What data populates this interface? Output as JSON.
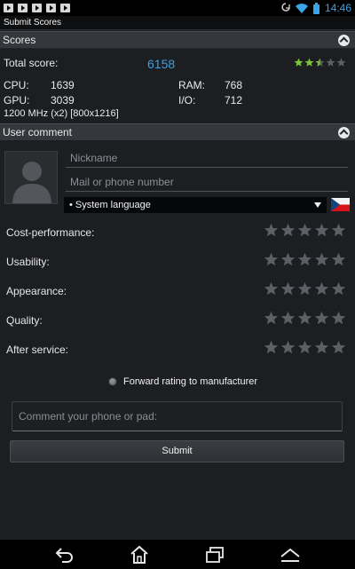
{
  "status_bar": {
    "time": "14:46",
    "icons": [
      "media-icon",
      "media-icon",
      "media-icon",
      "media-icon",
      "media-icon",
      "sync-icon",
      "wifi-icon",
      "battery-icon"
    ]
  },
  "window": {
    "title": "Submit Scores"
  },
  "scores": {
    "header": "Scores",
    "total_label": "Total score:",
    "total_value": "6158",
    "rating": 2.5,
    "rating_max": 5,
    "cpu_label": "CPU:",
    "cpu_value": "1639",
    "gpu_label": "GPU:",
    "gpu_value": "3039",
    "ram_label": "RAM:",
    "ram_value": "768",
    "io_label": "I/O:",
    "io_value": "712",
    "device_info": "1200 MHz (x2) [800x1216]"
  },
  "comment": {
    "header": "User comment",
    "nickname_placeholder": "Nickname",
    "contact_placeholder": "Mail or phone number",
    "language": "• System language",
    "flag_icon": "czech-flag-icon",
    "ratings": [
      {
        "label": "Cost-performance:",
        "value": 0
      },
      {
        "label": "Usability:",
        "value": 0
      },
      {
        "label": "Appearance:",
        "value": 0
      },
      {
        "label": "Quality:",
        "value": 0
      },
      {
        "label": "After service:",
        "value": 0
      }
    ],
    "forward_label": "Forward rating to manufacturer",
    "comment_placeholder": "Comment your phone or pad:",
    "submit_label": "Submit"
  },
  "colors": {
    "accent": "#3d9ee0",
    "star_filled": "#7ec43a",
    "star_empty": "#5c5f63",
    "background": "#1c1e22"
  }
}
